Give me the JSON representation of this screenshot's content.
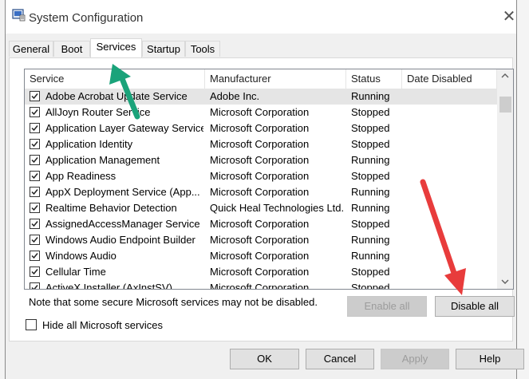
{
  "window": {
    "title": "System Configuration",
    "close_glyph": "✕"
  },
  "tabs": [
    {
      "label": "General",
      "active": false
    },
    {
      "label": "Boot",
      "active": false
    },
    {
      "label": "Services",
      "active": true
    },
    {
      "label": "Startup",
      "active": false
    },
    {
      "label": "Tools",
      "active": false
    }
  ],
  "services": {
    "columns": [
      "Service",
      "Manufacturer",
      "Status",
      "Date Disabled"
    ],
    "rows": [
      {
        "checked": true,
        "service": "Adobe Acrobat Update Service",
        "manufacturer": "Adobe Inc.",
        "status": "Running",
        "date_disabled": ""
      },
      {
        "checked": true,
        "service": "AllJoyn Router Service",
        "manufacturer": "Microsoft Corporation",
        "status": "Stopped",
        "date_disabled": ""
      },
      {
        "checked": true,
        "service": "Application Layer Gateway Service",
        "manufacturer": "Microsoft Corporation",
        "status": "Stopped",
        "date_disabled": ""
      },
      {
        "checked": true,
        "service": "Application Identity",
        "manufacturer": "Microsoft Corporation",
        "status": "Stopped",
        "date_disabled": ""
      },
      {
        "checked": true,
        "service": "Application Management",
        "manufacturer": "Microsoft Corporation",
        "status": "Running",
        "date_disabled": ""
      },
      {
        "checked": true,
        "service": "App Readiness",
        "manufacturer": "Microsoft Corporation",
        "status": "Stopped",
        "date_disabled": ""
      },
      {
        "checked": true,
        "service": "AppX Deployment Service (App...",
        "manufacturer": "Microsoft Corporation",
        "status": "Running",
        "date_disabled": ""
      },
      {
        "checked": true,
        "service": "Realtime Behavior Detection",
        "manufacturer": "Quick Heal Technologies Ltd.",
        "status": "Running",
        "date_disabled": ""
      },
      {
        "checked": true,
        "service": "AssignedAccessManager Service",
        "manufacturer": "Microsoft Corporation",
        "status": "Stopped",
        "date_disabled": ""
      },
      {
        "checked": true,
        "service": "Windows Audio Endpoint Builder",
        "manufacturer": "Microsoft Corporation",
        "status": "Running",
        "date_disabled": ""
      },
      {
        "checked": true,
        "service": "Windows Audio",
        "manufacturer": "Microsoft Corporation",
        "status": "Running",
        "date_disabled": ""
      },
      {
        "checked": true,
        "service": "Cellular Time",
        "manufacturer": "Microsoft Corporation",
        "status": "Stopped",
        "date_disabled": ""
      },
      {
        "checked": true,
        "service": "ActiveX Installer (AxInstSV)",
        "manufacturer": "Microsoft Corporation",
        "status": "Stopped",
        "date_disabled": ""
      }
    ]
  },
  "note": "Note that some secure Microsoft services may not be disabled.",
  "buttons": {
    "enable_all": "Enable all",
    "disable_all": "Disable all",
    "ok": "OK",
    "cancel": "Cancel",
    "apply": "Apply",
    "help": "Help"
  },
  "hide_ms": {
    "label": "Hide all Microsoft services",
    "checked": false
  },
  "annotations": {
    "tab_arrow_color": "#1aa37a",
    "button_arrow_color": "#e83c3c"
  }
}
